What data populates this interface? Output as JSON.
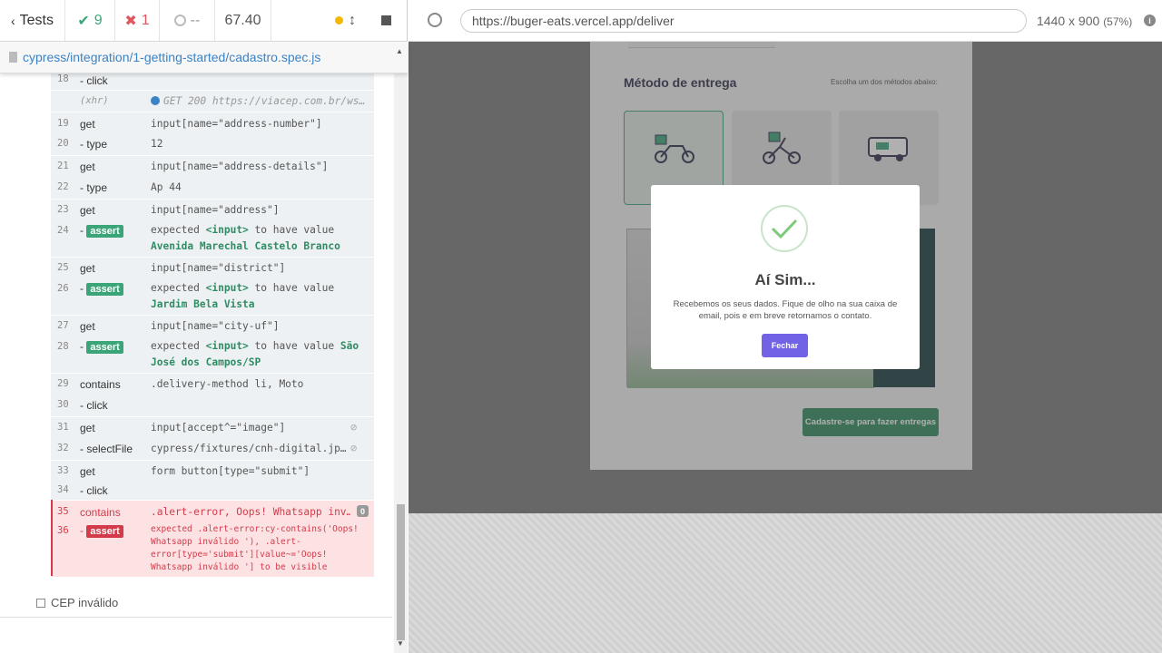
{
  "header": {
    "tests_label": "Tests",
    "passed": "9",
    "failed": "1",
    "pending": "--",
    "duration": "67.40"
  },
  "spec": {
    "path": "cypress/integration/1-getting-started/cadastro.spec.js"
  },
  "commands": [
    {
      "num": "18",
      "name": "- click",
      "msg": ""
    },
    {
      "num": "",
      "name": "(xhr)",
      "msg": "GET 200 https://viacep.com.br/ws…"
    },
    {
      "num": "19",
      "name": "get",
      "msg": "input[name=\"address-number\"]"
    },
    {
      "num": "20",
      "name": "- type",
      "msg": "12"
    },
    {
      "num": "21",
      "name": "get",
      "msg": "input[name=\"address-details\"]"
    },
    {
      "num": "22",
      "name": "- type",
      "msg": "Ap 44"
    },
    {
      "num": "23",
      "name": "get",
      "msg": "input[name=\"address\"]"
    },
    {
      "num": "24",
      "name": "assert",
      "msg_pre": "expected",
      "msg_el": "<input>",
      "msg_mid": "to have value",
      "msg_val": "Avenida Marechal Castelo Branco"
    },
    {
      "num": "25",
      "name": "get",
      "msg": "input[name=\"district\"]"
    },
    {
      "num": "26",
      "name": "assert",
      "msg_pre": "expected",
      "msg_el": "<input>",
      "msg_mid": "to have value",
      "msg_val": "Jardim Bela Vista"
    },
    {
      "num": "27",
      "name": "get",
      "msg": "input[name=\"city-uf\"]"
    },
    {
      "num": "28",
      "name": "assert",
      "msg_pre": "expected",
      "msg_el": "<input>",
      "msg_mid": "to have value",
      "msg_val": "São José dos Campos/SP"
    },
    {
      "num": "29",
      "name": "contains",
      "msg": ".delivery-method li, Moto"
    },
    {
      "num": "30",
      "name": "- click",
      "msg": ""
    },
    {
      "num": "31",
      "name": "get",
      "msg": "input[accept^=\"image\"]"
    },
    {
      "num": "32",
      "name": "- selectFile",
      "msg": "cypress/fixtures/cnh-digital.jp…"
    },
    {
      "num": "33",
      "name": "get",
      "msg": "form button[type=\"submit\"]"
    },
    {
      "num": "34",
      "name": "- click",
      "msg": ""
    },
    {
      "num": "35",
      "name": "contains",
      "msg": ".alert-error, Oops! Whatsapp inv…",
      "badge": "0"
    },
    {
      "num": "36",
      "name": "assert",
      "msg": "expected .alert-error:cy-contains('Oops! Whatsapp inválido '), .alert-error[type='submit'][value~='Oops! Whatsapp inválido '] to be visible"
    }
  ],
  "next_test": {
    "label": "CEP inválido"
  },
  "browser": {
    "url": "https://buger-eats.vercel.app/deliver",
    "viewport": "1440 x 900",
    "scale": "(57%)"
  },
  "app": {
    "section_title": "Método de entrega",
    "section_hint": "Escolha um dos métodos abaixo:",
    "submit_label": "Cadastre-se para fazer entregas",
    "modal_title": "Aí Sim...",
    "modal_text": "Recebemos os seus dados. Fique de olho na sua caixa de email, pois e em breve retornamos o contato.",
    "modal_button": "Fechar"
  },
  "colors": {
    "pass": "#3ba57a",
    "fail": "#d33b4a",
    "accent": "#7262e6"
  }
}
